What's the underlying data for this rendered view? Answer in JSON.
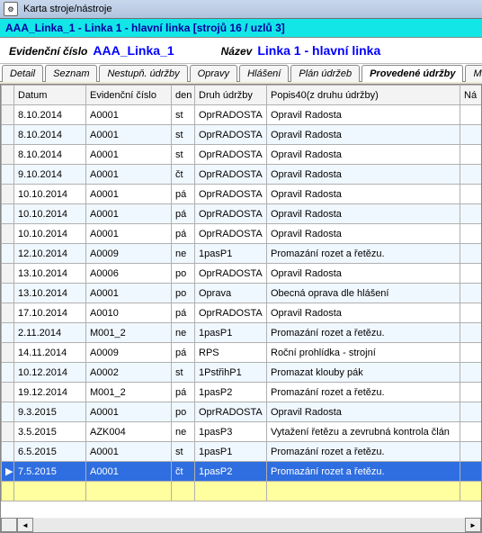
{
  "window": {
    "title": "Karta stroje/nástroje"
  },
  "subheader": "AAA_Linka_1 - Linka 1 - hlavní linka [strojů 16 / uzlů 3]",
  "info": {
    "field1_label": "Evidenční číslo",
    "field1_value": "AAA_Linka_1",
    "field2_label": "Název",
    "field2_value": "Linka 1 - hlavní linka"
  },
  "tabs": [
    {
      "label": "Detail"
    },
    {
      "label": "Seznam"
    },
    {
      "label": "Nestupň. údržby"
    },
    {
      "label": "Opravy"
    },
    {
      "label": "Hlášení"
    },
    {
      "label": "Plán údržeb"
    },
    {
      "label": "Provedené údržby",
      "active": true
    },
    {
      "label": "MTB"
    }
  ],
  "columns": {
    "indicator": "",
    "datum": "Datum",
    "ev": "Evidenční číslo",
    "den": "den",
    "druh": "Druh údržby",
    "popis": "Popis40(z druhu údržby)",
    "na": "Ná"
  },
  "rows": [
    {
      "sel": false,
      "alt": false,
      "datum": "8.10.2014",
      "ev": "A0001",
      "den": "st",
      "druh": "OprRADOSTA",
      "popis": "Opravil Radosta"
    },
    {
      "sel": false,
      "alt": true,
      "datum": "8.10.2014",
      "ev": "A0001",
      "den": "st",
      "druh": "OprRADOSTA",
      "popis": "Opravil Radosta"
    },
    {
      "sel": false,
      "alt": false,
      "datum": "8.10.2014",
      "ev": "A0001",
      "den": "st",
      "druh": "OprRADOSTA",
      "popis": "Opravil Radosta"
    },
    {
      "sel": false,
      "alt": true,
      "datum": "9.10.2014",
      "ev": "A0001",
      "den": "čt",
      "druh": "OprRADOSTA",
      "popis": "Opravil Radosta"
    },
    {
      "sel": false,
      "alt": false,
      "datum": "10.10.2014",
      "ev": "A0001",
      "den": "pá",
      "druh": "OprRADOSTA",
      "popis": "Opravil Radosta"
    },
    {
      "sel": false,
      "alt": true,
      "datum": "10.10.2014",
      "ev": "A0001",
      "den": "pá",
      "druh": "OprRADOSTA",
      "popis": "Opravil Radosta"
    },
    {
      "sel": false,
      "alt": false,
      "datum": "10.10.2014",
      "ev": "A0001",
      "den": "pá",
      "druh": "OprRADOSTA",
      "popis": "Opravil Radosta"
    },
    {
      "sel": false,
      "alt": true,
      "datum": "12.10.2014",
      "ev": "A0009",
      "den": "ne",
      "druh": "1pasP1",
      "popis": "Promazání rozet a řetězu."
    },
    {
      "sel": false,
      "alt": false,
      "datum": "13.10.2014",
      "ev": "A0006",
      "den": "po",
      "druh": "OprRADOSTA",
      "popis": "Opravil Radosta"
    },
    {
      "sel": false,
      "alt": true,
      "datum": "13.10.2014",
      "ev": "A0001",
      "den": "po",
      "druh": "Oprava",
      "popis": "Obecná oprava dle hlášení"
    },
    {
      "sel": false,
      "alt": false,
      "datum": "17.10.2014",
      "ev": "A0010",
      "den": "pá",
      "druh": "OprRADOSTA",
      "popis": "Opravil Radosta"
    },
    {
      "sel": false,
      "alt": true,
      "datum": "2.11.2014",
      "ev": "M001_2",
      "den": "ne",
      "druh": "1pasP1",
      "popis": "Promazání rozet a řetězu."
    },
    {
      "sel": false,
      "alt": false,
      "datum": "14.11.2014",
      "ev": "A0009",
      "den": "pá",
      "druh": "RPS",
      "popis": "Roční prohlídka - strojní"
    },
    {
      "sel": false,
      "alt": true,
      "datum": "10.12.2014",
      "ev": "A0002",
      "den": "st",
      "druh": "1PstřihP1",
      "popis": "Promazat klouby pák"
    },
    {
      "sel": false,
      "alt": false,
      "datum": "19.12.2014",
      "ev": "M001_2",
      "den": "pá",
      "druh": "1pasP2",
      "popis": "Promazání rozet a řetězu."
    },
    {
      "sel": false,
      "alt": true,
      "datum": "9.3.2015",
      "ev": "A0001",
      "den": "po",
      "druh": "OprRADOSTA",
      "popis": "Opravil Radosta"
    },
    {
      "sel": false,
      "alt": false,
      "datum": "3.5.2015",
      "ev": "AZK004",
      "den": "ne",
      "druh": "1pasP3",
      "popis": "Vytažení řetězu a zevrubná kontrola člán"
    },
    {
      "sel": false,
      "alt": true,
      "datum": "6.5.2015",
      "ev": "A0001",
      "den": "st",
      "druh": "1pasP1",
      "popis": "Promazání rozet a řetězu."
    },
    {
      "sel": true,
      "alt": false,
      "datum": "7.5.2015",
      "ev": "A0001",
      "den": "čt",
      "druh": "1pasP2",
      "popis": "Promazání rozet a řetězu."
    }
  ],
  "scroll": {
    "left_glyph": "◄",
    "right_glyph": "►"
  }
}
